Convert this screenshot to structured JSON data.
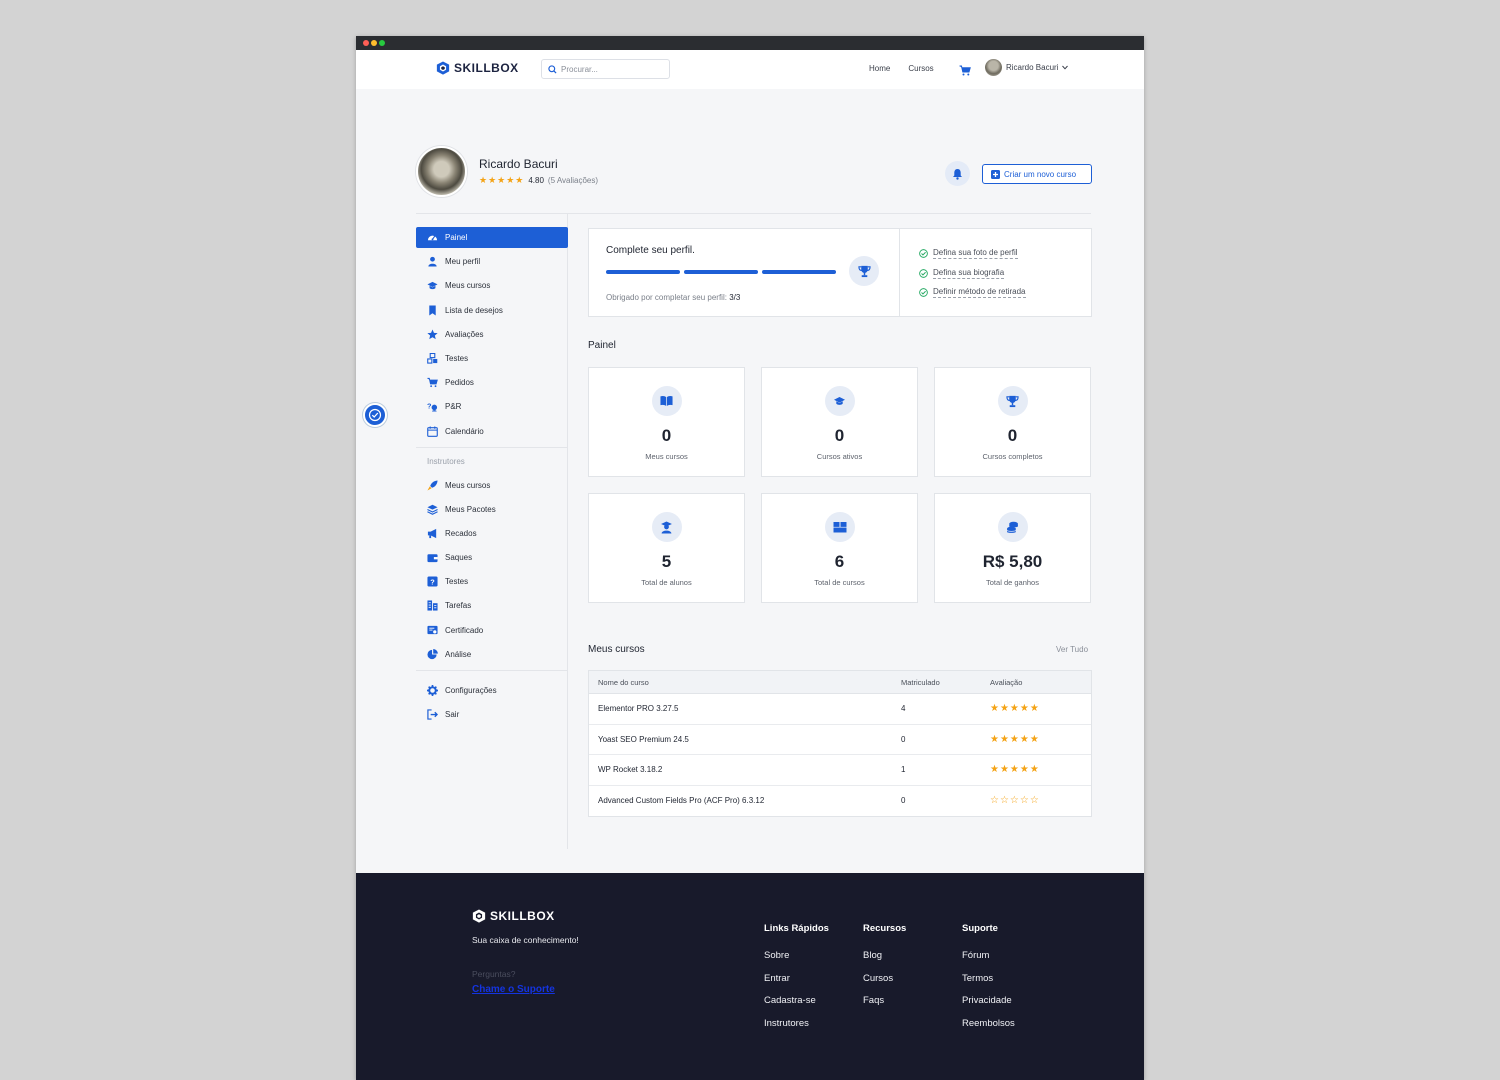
{
  "header": {
    "brand": "SKILLBOX",
    "search_placeholder": "Procurar...",
    "nav": [
      "Home",
      "Cursos"
    ],
    "user_name": "Ricardo Bacuri"
  },
  "profile": {
    "name": "Ricardo Bacuri",
    "rating_value": "4.80",
    "rating_count": "(5 Avaliações)",
    "stars": 5,
    "create_button": "Criar um novo curso"
  },
  "sidebar": {
    "items": [
      {
        "label": "Painel",
        "icon": "dashboard-icon",
        "active": true
      },
      {
        "label": "Meu perfil",
        "icon": "user-icon"
      },
      {
        "label": "Meus cursos",
        "icon": "graduation-cap-icon"
      },
      {
        "label": "Lista de desejos",
        "icon": "bookmark-icon"
      },
      {
        "label": "Avaliações",
        "icon": "star-icon"
      },
      {
        "label": "Testes",
        "icon": "puzzle-icon"
      },
      {
        "label": "Pedidos",
        "icon": "cart-icon"
      },
      {
        "label": "P&R",
        "icon": "question-icon"
      },
      {
        "label": "Calendário",
        "icon": "calendar-icon"
      }
    ],
    "instructor_label": "Instrutores",
    "instructor_items": [
      {
        "label": "Meus cursos",
        "icon": "rocket-icon"
      },
      {
        "label": "Meus Pacotes",
        "icon": "layers-icon"
      },
      {
        "label": "Recados",
        "icon": "megaphone-icon"
      },
      {
        "label": "Saques",
        "icon": "wallet-icon"
      },
      {
        "label": "Testes",
        "icon": "quiz-icon"
      },
      {
        "label": "Tarefas",
        "icon": "tasks-icon"
      },
      {
        "label": "Certificado",
        "icon": "certificate-icon"
      },
      {
        "label": "Análise",
        "icon": "pie-chart-icon"
      }
    ],
    "bottom_items": [
      {
        "label": "Configurações",
        "icon": "gear-icon"
      },
      {
        "label": "Sair",
        "icon": "logout-icon"
      }
    ]
  },
  "completion": {
    "title": "Complete seu perfil.",
    "subtitle_prefix": "Obrigado por completar seu perfil:",
    "subtitle_value": "3/3",
    "steps_total": 3,
    "steps_done": 3,
    "checklist": [
      "Defina sua foto de perfil",
      "Defina sua biografia",
      "Definir método de retirada"
    ]
  },
  "dashboard": {
    "title": "Painel",
    "stats": [
      {
        "value": "0",
        "label": "Meus cursos",
        "icon": "book-icon"
      },
      {
        "value": "0",
        "label": "Cursos ativos",
        "icon": "graduation-cap-icon"
      },
      {
        "value": "0",
        "label": "Cursos completos",
        "icon": "trophy-icon"
      },
      {
        "value": "5",
        "label": "Total de alunos",
        "icon": "student-icon"
      },
      {
        "value": "6",
        "label": "Total de cursos",
        "icon": "boxes-icon"
      },
      {
        "value": "R$ 5,80",
        "label": "Total de ganhos",
        "icon": "coins-icon"
      }
    ]
  },
  "courses": {
    "title": "Meus cursos",
    "view_all": "Ver Tudo",
    "columns": [
      "Nome do curso",
      "Matriculado",
      "Avaliação"
    ],
    "rows": [
      {
        "name": "Elementor PRO 3.27.5",
        "enrolled": "4",
        "rating": 5
      },
      {
        "name": "Yoast SEO Premium 24.5",
        "enrolled": "0",
        "rating": 5
      },
      {
        "name": "WP Rocket 3.18.2",
        "enrolled": "1",
        "rating": 5
      },
      {
        "name": "Advanced Custom Fields Pro (ACF Pro) 6.3.12",
        "enrolled": "0",
        "rating": 0
      }
    ]
  },
  "footer": {
    "brand": "SKILLBOX",
    "tagline": "Sua caixa de conhecimento!",
    "question": "Perguntas?",
    "support_link": "Chame o Suporte",
    "columns": [
      {
        "title": "Links Rápidos",
        "links": [
          "Sobre",
          "Entrar",
          "Cadastra-se",
          "Instrutores"
        ]
      },
      {
        "title": "Recursos",
        "links": [
          "Blog",
          "Cursos",
          "Faqs"
        ]
      },
      {
        "title": "Suporte",
        "links": [
          "Fórum",
          "Termos",
          "Privacidade",
          "Reembolsos"
        ]
      }
    ]
  },
  "colors": {
    "accent": "#1d5fd6",
    "star": "#f4a316",
    "footer_bg": "#181a2b"
  }
}
